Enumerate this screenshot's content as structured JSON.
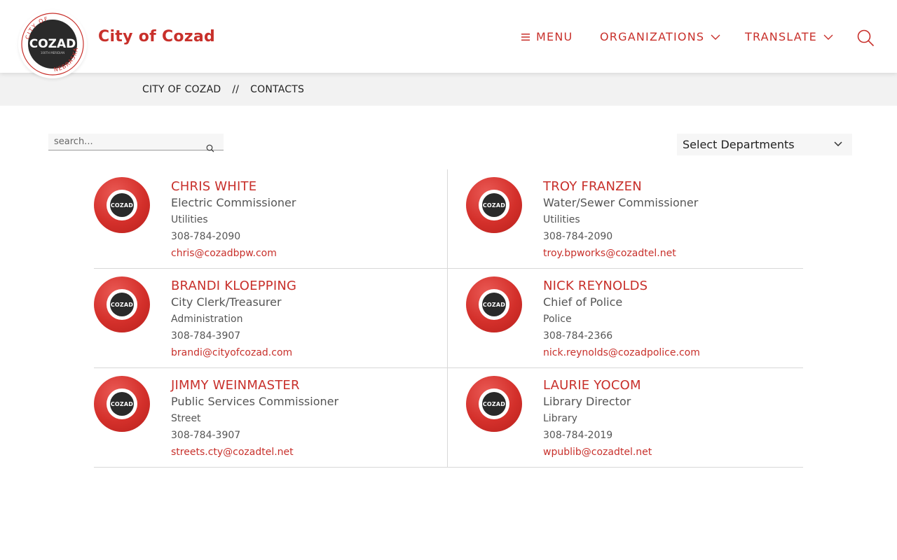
{
  "colors": {
    "brand": "#c8302b",
    "breadcrumb_bg": "#f2f2f2"
  },
  "header": {
    "site_title": "City of Cozad",
    "logo": {
      "ring_top": "CITY OF",
      "ring_bottom": "NEBRASKA",
      "center": "COZAD",
      "tagline": "100TH MERIDIAN"
    },
    "nav": {
      "menu": {
        "label": "MENU",
        "icon": "hamburger-icon"
      },
      "organizations": {
        "label": "ORGANIZATIONS",
        "icon": "chevron-down-icon"
      },
      "translate": {
        "label": "TRANSLATE",
        "icon": "chevron-down-icon"
      },
      "search_icon": "search-icon"
    }
  },
  "breadcrumb": {
    "home": "CITY OF COZAD",
    "separator": "//",
    "current": "CONTACTS"
  },
  "filters": {
    "search_placeholder": "search...",
    "search_icon": "search-icon",
    "department_select": "Select Departments"
  },
  "avatar_label": "COZAD",
  "contacts": [
    {
      "name": "CHRIS WHITE",
      "title": "Electric Commissioner",
      "department": "Utilities",
      "phone": "308-784-2090",
      "email": "chris@cozadbpw.com"
    },
    {
      "name": "TROY FRANZEN",
      "title": "Water/Sewer Commissioner",
      "department": "Utilities",
      "phone": "308-784-2090",
      "email": "troy.bpworks@cozadtel.net"
    },
    {
      "name": "BRANDI KLOEPPING",
      "title": "City Clerk/Treasurer",
      "department": "Administration",
      "phone": "308-784-3907",
      "email": "brandi@cityofcozad.com"
    },
    {
      "name": "NICK REYNOLDS",
      "title": "Chief of Police",
      "department": "Police",
      "phone": "308-784-2366",
      "email": "nick.reynolds@cozadpolice.com"
    },
    {
      "name": "JIMMY WEINMASTER",
      "title": "Public Services Commissioner",
      "department": "Street",
      "phone": "308-784-3907",
      "email": "streets.cty@cozadtel.net"
    },
    {
      "name": "LAURIE YOCOM",
      "title": "Library Director",
      "department": "Library",
      "phone": "308-784-2019",
      "email": "wpublib@cozadtel.net"
    }
  ]
}
